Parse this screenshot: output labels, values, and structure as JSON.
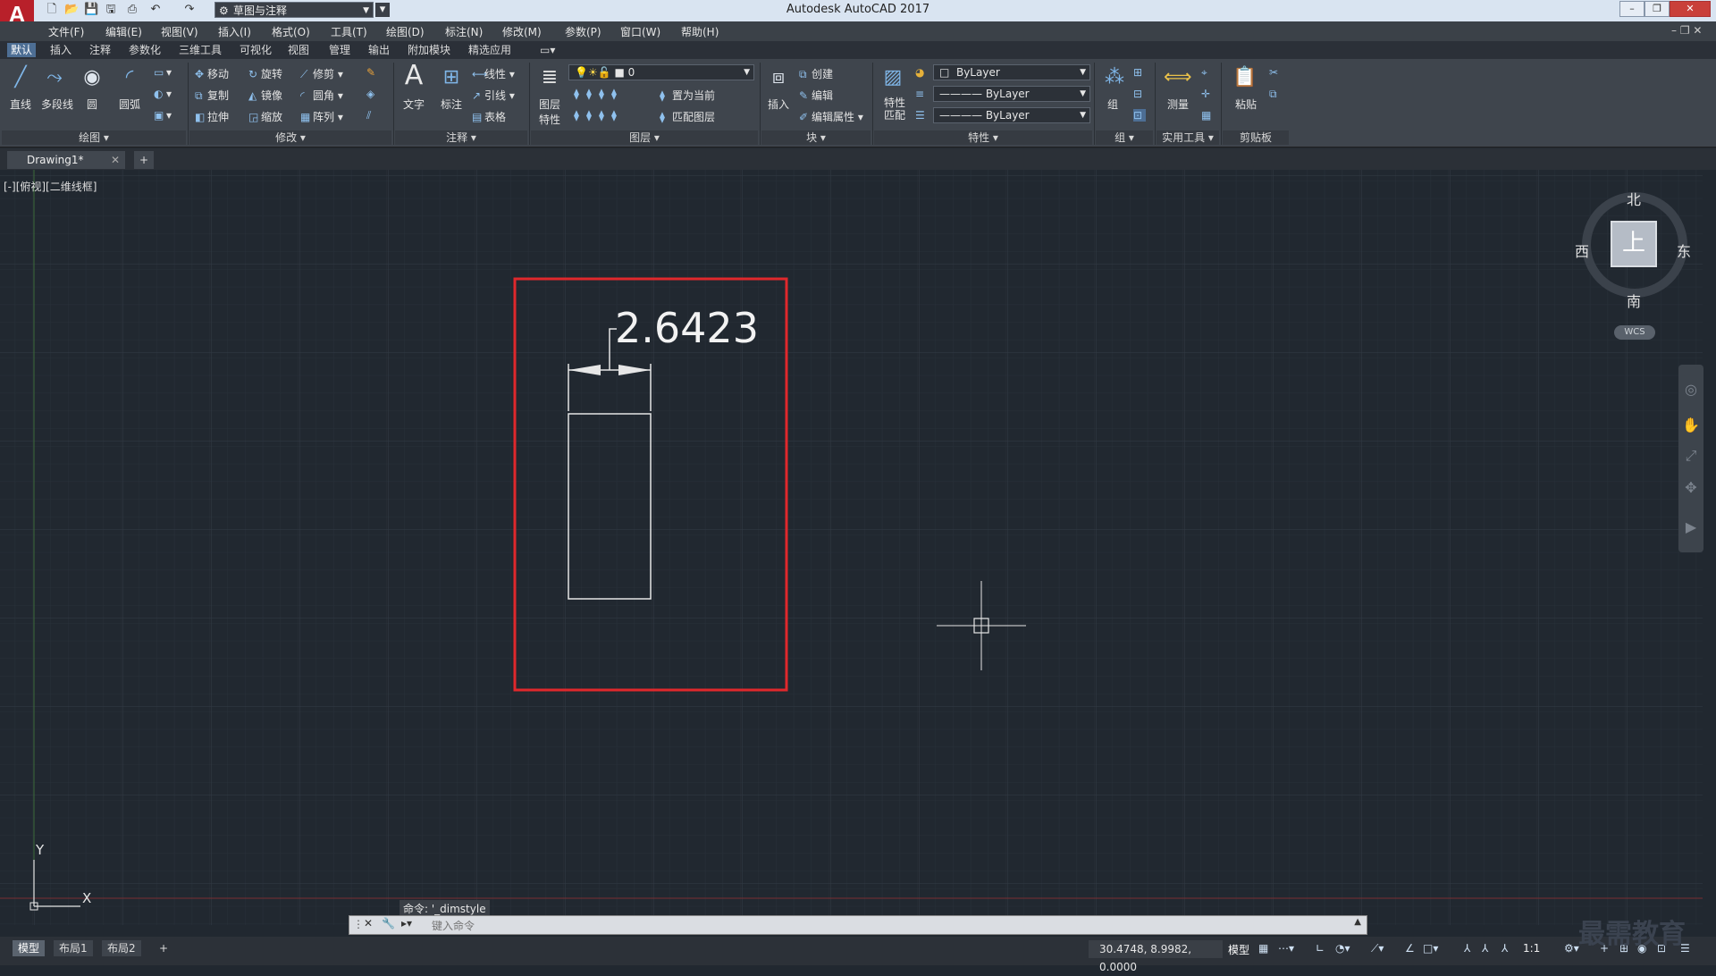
{
  "app": {
    "title": "Autodesk AutoCAD 2017",
    "logo": "A",
    "workspace": "草图与注释"
  },
  "menu": [
    "文件(F)",
    "编辑(E)",
    "视图(V)",
    "插入(I)",
    "格式(O)",
    "工具(T)",
    "绘图(D)",
    "标注(N)",
    "修改(M)",
    "参数(P)",
    "窗口(W)",
    "帮助(H)"
  ],
  "ribbon_tabs": [
    "默认",
    "插入",
    "注释",
    "参数化",
    "三维工具",
    "可视化",
    "视图",
    "管理",
    "输出",
    "附加模块",
    "精选应用"
  ],
  "ribbon": {
    "draw": {
      "title": "绘图",
      "line": "直线",
      "polyline": "多段线",
      "circle": "圆",
      "arc": "圆弧"
    },
    "modify": {
      "title": "修改",
      "move": "移动",
      "rotate": "旋转",
      "trim": "修剪",
      "copy": "复制",
      "mirror": "镜像",
      "fillet": "圆角",
      "stretch": "拉伸",
      "scale": "缩放",
      "array": "阵列"
    },
    "annotation": {
      "title": "注释",
      "text": "文字",
      "dimension": "标注",
      "linear": "线性",
      "leader": "引线",
      "table": "表格"
    },
    "layers": {
      "title": "图层",
      "layer_props": "图层特性",
      "current_layer": "0",
      "set_current": "置为当前",
      "match_layer": "匹配图层"
    },
    "block": {
      "title": "块",
      "insert": "插入",
      "create": "创建",
      "edit": "编辑",
      "edit_attr": "编辑属性"
    },
    "properties": {
      "title": "特性",
      "match": "特性匹配",
      "color": "ByLayer",
      "linetype": "ByLayer",
      "lineweight": "ByLayer"
    },
    "groups": {
      "title": "组",
      "group": "组"
    },
    "utilities": {
      "title": "实用工具",
      "measure": "测量"
    },
    "clipboard": {
      "title": "剪贴板",
      "paste": "粘贴"
    }
  },
  "doc_tab": "Drawing1*",
  "view_label": "[-][俯视][二维线框]",
  "drawing": {
    "dimension_text": "2.6423"
  },
  "viewcube": {
    "north": "北",
    "south": "南",
    "east": "东",
    "west": "西",
    "top": "上",
    "wcs": "WCS"
  },
  "ucs": {
    "x": "X",
    "y": "Y"
  },
  "command": {
    "history": "命令: '_dimstyle",
    "placeholder": "键入命令"
  },
  "layout_tabs": [
    "模型",
    "布局1",
    "布局2"
  ],
  "status": {
    "coords": "30.4748, 8.9982, 0.0000",
    "mode": "模型",
    "scale": "1:1"
  },
  "watermark": "最需教育",
  "colors": {
    "highlight_box": "#e0282c",
    "canvas": "#212830",
    "accent_tab": "#4d6e94"
  }
}
